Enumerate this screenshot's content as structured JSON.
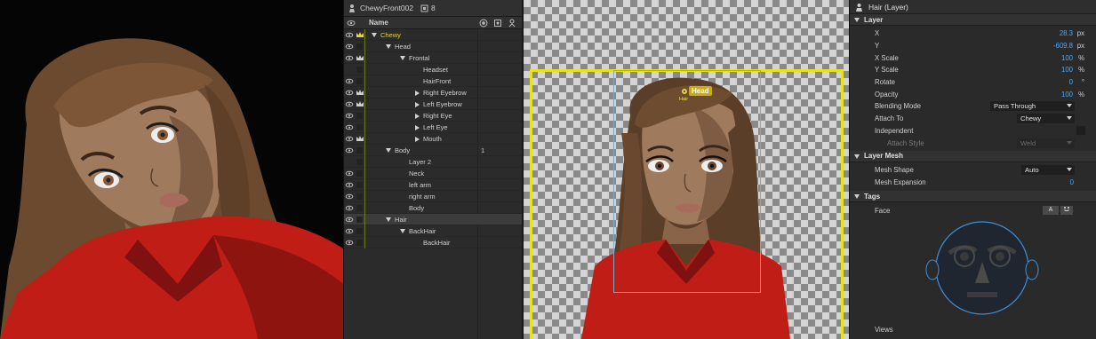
{
  "scene": {
    "description_icons": "character-preview"
  },
  "puppet_panel": {
    "title": "ChewyFront002",
    "count": "8",
    "columns": {
      "name": "Name"
    },
    "rows": [
      {
        "label": "Chewy",
        "depth": 0,
        "expand": "open",
        "highlight": true,
        "crown": true,
        "eye": true
      },
      {
        "label": "Head",
        "depth": 1,
        "expand": "open",
        "crown": false,
        "eye": true
      },
      {
        "label": "Frontal",
        "depth": 2,
        "expand": "open",
        "crown": true,
        "eye": true
      },
      {
        "label": "Headset",
        "depth": 3,
        "expand": "none",
        "crown": false,
        "eye": false
      },
      {
        "label": "HairFront",
        "depth": 3,
        "expand": "none",
        "crown": false,
        "eye": true
      },
      {
        "label": "Right Eyebrow",
        "depth": 3,
        "expand": "closed",
        "crown": true,
        "eye": true
      },
      {
        "label": "Left Eyebrow",
        "depth": 3,
        "expand": "closed",
        "crown": true,
        "eye": true
      },
      {
        "label": "Right Eye",
        "depth": 3,
        "expand": "closed",
        "crown": false,
        "eye": true
      },
      {
        "label": "Left Eye",
        "depth": 3,
        "expand": "closed",
        "crown": false,
        "eye": true
      },
      {
        "label": "Mouth",
        "depth": 3,
        "expand": "closed",
        "crown": true,
        "eye": true
      },
      {
        "label": "Body",
        "depth": 1,
        "expand": "open",
        "crown": false,
        "eye": true,
        "num": "1"
      },
      {
        "label": "Layer 2",
        "depth": 2,
        "expand": "none",
        "crown": false,
        "eye": false
      },
      {
        "label": "Neck",
        "depth": 2,
        "expand": "none",
        "crown": false,
        "eye": true
      },
      {
        "label": "left arm",
        "depth": 2,
        "expand": "none",
        "crown": false,
        "eye": true
      },
      {
        "label": "right arm",
        "depth": 2,
        "expand": "none",
        "crown": false,
        "eye": true
      },
      {
        "label": "Body",
        "depth": 2,
        "expand": "none",
        "crown": false,
        "eye": true
      },
      {
        "label": "Hair",
        "depth": 1,
        "expand": "open",
        "crown": false,
        "eye": true,
        "selected": true
      },
      {
        "label": "BackHair",
        "depth": 2,
        "expand": "open",
        "crown": false,
        "eye": true
      },
      {
        "label": "BackHair",
        "depth": 3,
        "expand": "none",
        "crown": false,
        "eye": true
      }
    ]
  },
  "canvas": {
    "handle_label": "Head",
    "handle_sublabel": "Hair"
  },
  "properties": {
    "title": "Hair (Layer)",
    "layer_section": "Layer",
    "x_label": "X",
    "x_value": "28.3",
    "x_unit": "px",
    "y_label": "Y",
    "y_value": "-609.8",
    "y_unit": "px",
    "xscale_label": "X Scale",
    "xscale_value": "100",
    "xscale_unit": "%",
    "yscale_label": "Y Scale",
    "yscale_value": "100",
    "yscale_unit": "%",
    "rotate_label": "Rotate",
    "rotate_value": "0",
    "rotate_unit": "°",
    "opacity_label": "Opacity",
    "opacity_value": "100",
    "opacity_unit": "%",
    "blending_label": "Blending Mode",
    "blending_value": "Pass Through",
    "attach_label": "Attach To",
    "attach_value": "Chewy",
    "independent_label": "Independent",
    "attach_style_label": "Attach Style",
    "attach_style_value": "Weld",
    "mesh_section": "Layer Mesh",
    "mesh_shape_label": "Mesh Shape",
    "mesh_shape_value": "Auto",
    "mesh_exp_label": "Mesh Expansion",
    "mesh_exp_value": "0",
    "tags_section": "Tags",
    "face_label": "Face",
    "face_btn": "A",
    "views_label": "Views"
  },
  "colors": {
    "accent_blue": "#46a9ff",
    "selection_yellow": "#e6e21e",
    "handle_gold": "#c9ac10"
  }
}
